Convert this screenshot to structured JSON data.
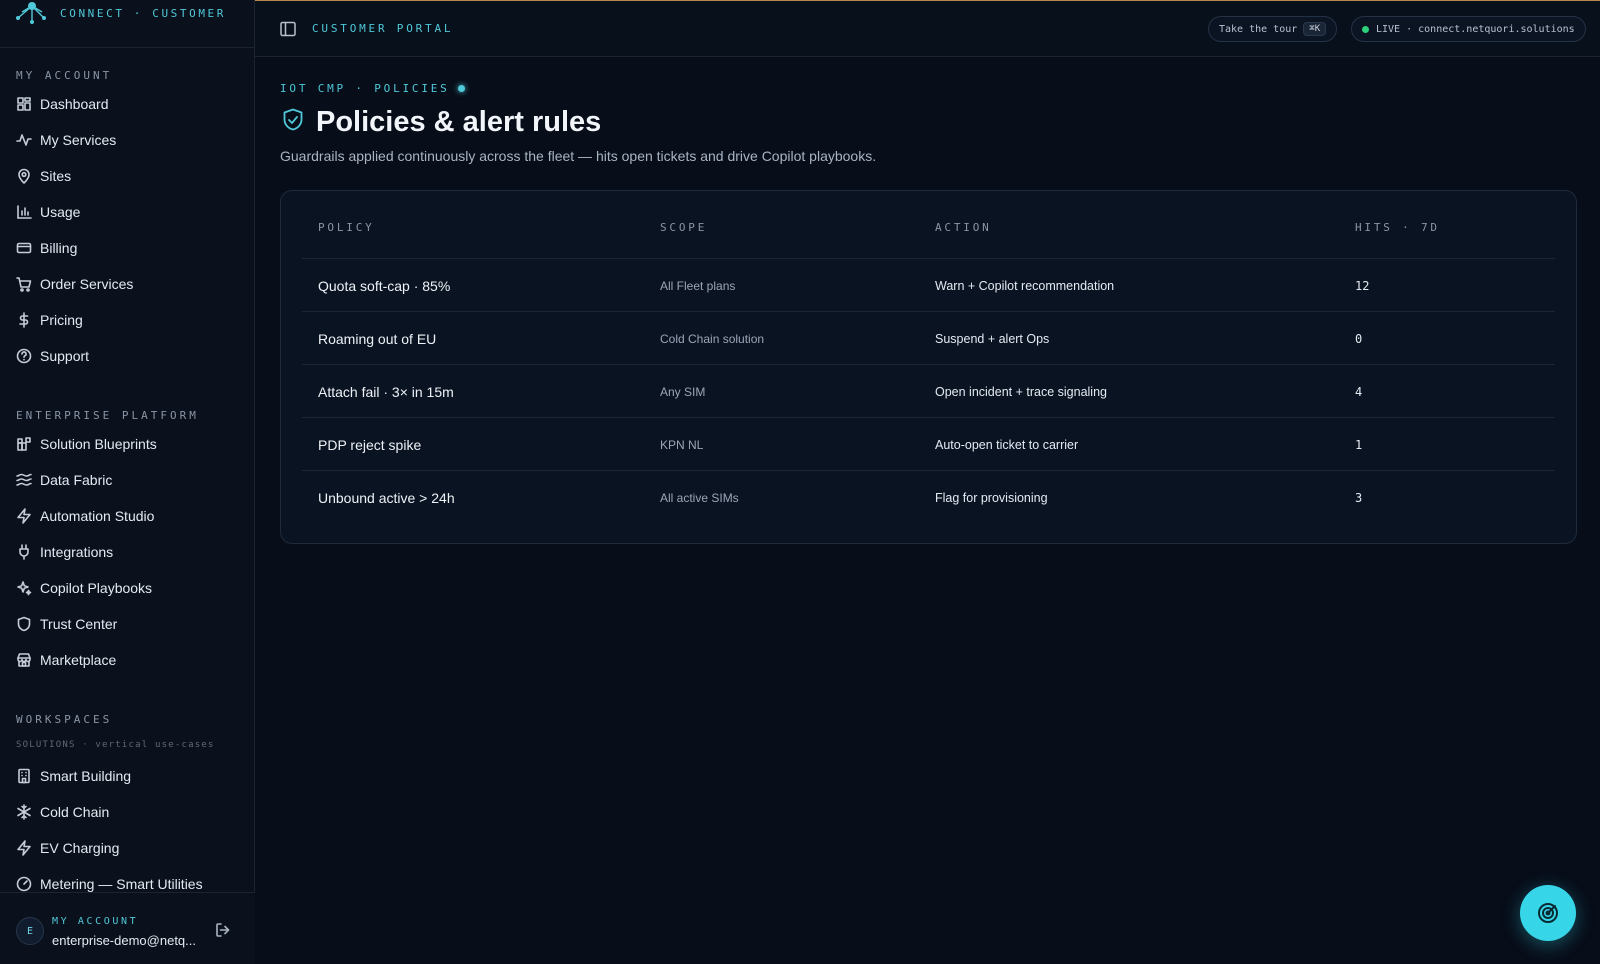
{
  "brand": {
    "subtitle": "CONNECT · CUSTOMER"
  },
  "sidebar": {
    "my_account_label": "MY ACCOUNT",
    "my_account_items": [
      {
        "label": "Dashboard",
        "icon": "dashboard-icon"
      },
      {
        "label": "My Services",
        "icon": "activity-icon"
      },
      {
        "label": "Sites",
        "icon": "map-pin-icon"
      },
      {
        "label": "Usage",
        "icon": "bar-chart-icon"
      },
      {
        "label": "Billing",
        "icon": "credit-card-icon"
      },
      {
        "label": "Order Services",
        "icon": "cart-icon"
      },
      {
        "label": "Pricing",
        "icon": "dollar-icon"
      },
      {
        "label": "Support",
        "icon": "help-circle-icon"
      }
    ],
    "enterprise_label": "ENTERPRISE PLATFORM",
    "enterprise_items": [
      {
        "label": "Solution Blueprints",
        "icon": "blueprints-icon"
      },
      {
        "label": "Data Fabric",
        "icon": "waves-icon"
      },
      {
        "label": "Automation Studio",
        "icon": "zap-icon"
      },
      {
        "label": "Integrations",
        "icon": "plug-icon"
      },
      {
        "label": "Copilot Playbooks",
        "icon": "sparkles-icon"
      },
      {
        "label": "Trust Center",
        "icon": "shield-icon"
      },
      {
        "label": "Marketplace",
        "icon": "store-icon"
      }
    ],
    "workspaces_label": "WORKSPACES",
    "workspaces_sub": "SOLUTIONS · vertical use-cases",
    "workspace_items": [
      {
        "label": "Smart Building",
        "icon": "building-icon"
      },
      {
        "label": "Cold Chain",
        "icon": "snowflake-icon"
      },
      {
        "label": "EV Charging",
        "icon": "zap-icon"
      },
      {
        "label": "Metering — Smart Utilities",
        "icon": "gauge-icon"
      }
    ],
    "account": {
      "avatar_letter": "E",
      "label": "MY ACCOUNT",
      "email": "enterprise-demo@netq..."
    }
  },
  "topbar": {
    "title": "CUSTOMER PORTAL",
    "tour_label": "Take the tour",
    "tour_shortcut": "⌘K",
    "live_label": "LIVE · connect.netquori.solutions"
  },
  "page": {
    "breadcrumb": "IOT CMP · POLICIES",
    "title": "Policies & alert rules",
    "subtitle": "Guardrails applied continuously across the fleet — hits open tickets and drive Copilot playbooks."
  },
  "table": {
    "headers": {
      "policy": "POLICY",
      "scope": "SCOPE",
      "action": "ACTION",
      "hits": "HITS · 7D"
    },
    "rows": [
      {
        "policy": "Quota soft-cap · 85%",
        "scope": "All Fleet plans",
        "action": "Warn + Copilot recommendation",
        "hits": "12"
      },
      {
        "policy": "Roaming out of EU",
        "scope": "Cold Chain solution",
        "action": "Suspend + alert Ops",
        "hits": "0"
      },
      {
        "policy": "Attach fail · 3× in 15m",
        "scope": "Any SIM",
        "action": "Open incident + trace signaling",
        "hits": "4"
      },
      {
        "policy": "PDP reject spike",
        "scope": "KPN NL",
        "action": "Auto-open ticket to carrier",
        "hits": "1"
      },
      {
        "policy": "Unbound active > 24h",
        "scope": "All active SIMs",
        "action": "Flag for provisioning",
        "hits": "3"
      }
    ]
  },
  "colors": {
    "accent": "#4fc9d9",
    "live": "#2bd07a",
    "fab": "#36d6e8",
    "background": "#070d19"
  }
}
